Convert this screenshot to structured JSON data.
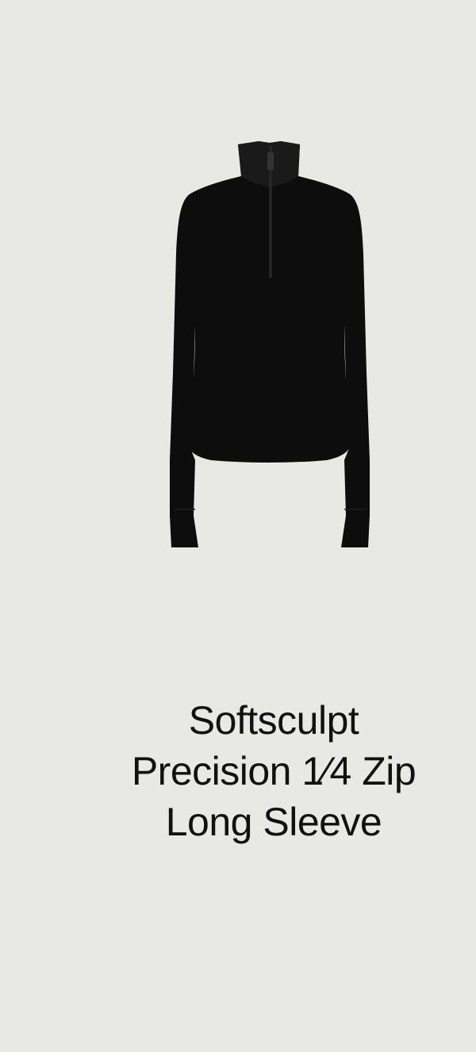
{
  "colors": {
    "background": "#e8e8e4",
    "garment": "#0d0d0d",
    "text": "#111111"
  },
  "product": {
    "image_name": "black-quarter-zip-long-sleeve-top",
    "title_lines": [
      "Softsculpt",
      "Precision 1⁄4 Zip",
      "Long Sleeve"
    ]
  }
}
